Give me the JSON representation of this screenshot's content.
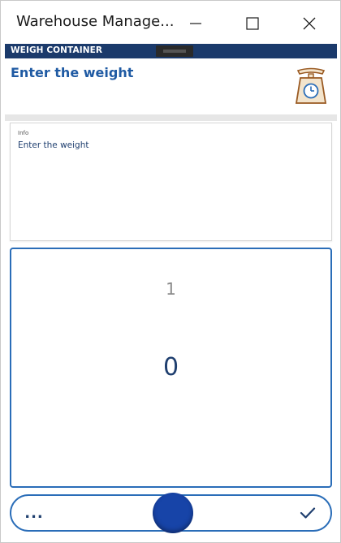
{
  "window": {
    "title": "Warehouse Manage..."
  },
  "header": {
    "label": "WEIGH CONTAINER"
  },
  "subheader": {
    "text": "Enter the weight",
    "icon": "scale-icon"
  },
  "info": {
    "caption": "Info",
    "message": "Enter the weight"
  },
  "input": {
    "quantity": "1",
    "weight": "0"
  },
  "bottom_bar": {
    "more_label": "...",
    "scan_icon": "circle-button",
    "confirm_icon": "checkmark-icon"
  },
  "colors": {
    "header_bg": "#1b3a6b",
    "accent": "#2a6db8",
    "heading_text": "#1f5aa3",
    "scan_button": "#1744a8"
  }
}
